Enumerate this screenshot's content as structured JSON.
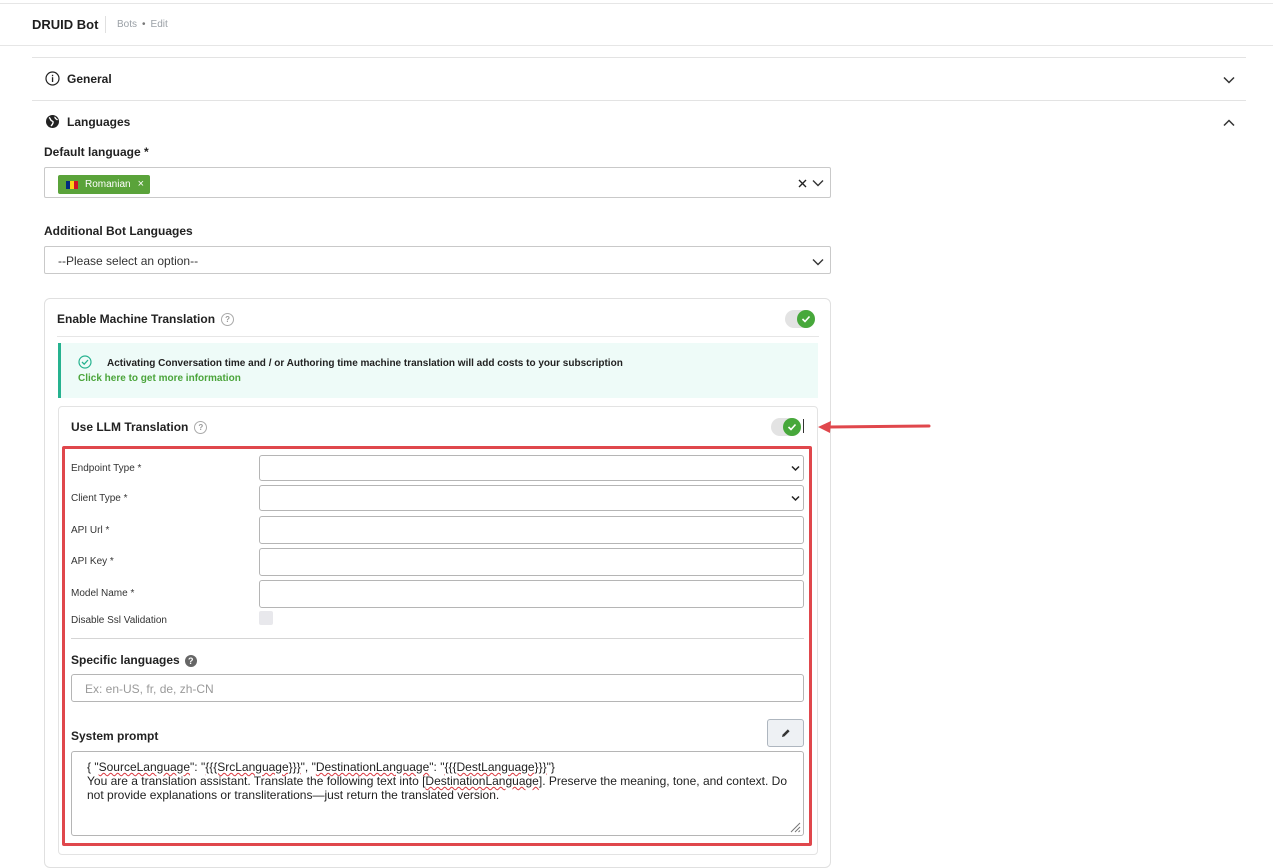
{
  "header": {
    "app_title": "DRUID Bot",
    "breadcrumbs": [
      "Bots",
      "Edit"
    ]
  },
  "sections": {
    "general": {
      "title": "General"
    },
    "languages": {
      "title": "Languages"
    }
  },
  "default_language": {
    "label": "Default language *",
    "selected_tag": "Romanian"
  },
  "additional_languages": {
    "label": "Additional Bot Languages",
    "placeholder": "--Please select an option--"
  },
  "machine_translation": {
    "label": "Enable Machine Translation",
    "enabled": true,
    "info_text": "Activating Conversation time and / or Authoring time machine translation will add costs to your subscription",
    "info_link": "Click here to get more information"
  },
  "llm_translation": {
    "label": "Use LLM Translation",
    "enabled": true,
    "fields": {
      "endpoint_type": "Endpoint Type *",
      "client_type": "Client Type *",
      "api_url": "API Url *",
      "api_key": "API Key *",
      "model_name": "Model Name *",
      "disable_ssl": "Disable Ssl Validation"
    },
    "specific_languages": {
      "label": "Specific languages",
      "placeholder": "Ex: en-US, fr, de, zh-CN"
    },
    "system_prompt": {
      "label": "System prompt",
      "line1_parts": [
        "{ \"",
        "SourceLanguage",
        "\": \"",
        "{{{SrcLanguage}}}",
        "\", \"",
        "DestinationLanguage",
        "\": \"",
        "{{{DestLanguage}}}",
        "\"}"
      ],
      "line2_parts": [
        "You are a translation assistant. Translate the following text into [",
        "DestinationLanguage",
        "]. Preserve the meaning, tone, and context. Do not provide explanations or transliterations—just return the translated version."
      ]
    }
  },
  "colors": {
    "accent_green": "#47a83b",
    "highlight_red": "#e0474c",
    "info_bg": "#eefbf8"
  }
}
